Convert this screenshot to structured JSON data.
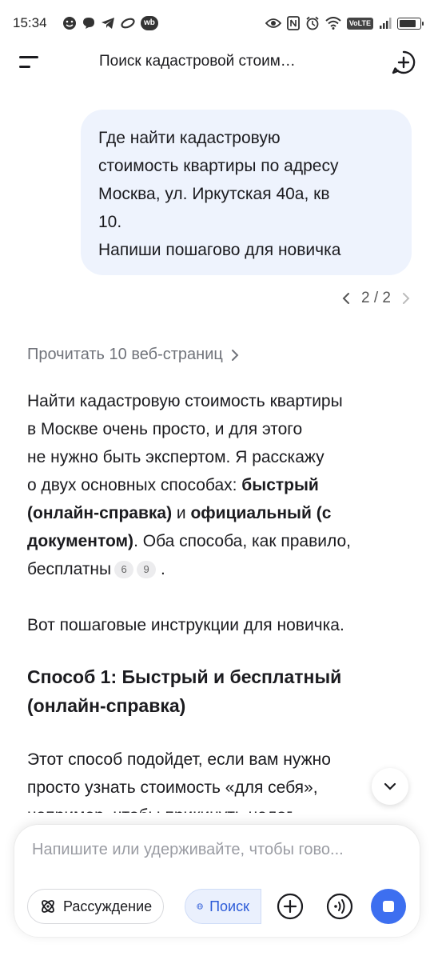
{
  "status_bar": {
    "time": "15:34",
    "wb_badge": "wb",
    "network_badge": "VoLTE",
    "battery_percent": 85
  },
  "header": {
    "title": "Поиск кадастровой стоим…"
  },
  "user_message": {
    "lines": [
      "Где найти кадастровую",
      "стоимость квартиры  по адресу",
      "Москва, ул. Иркутская 40а, кв",
      "10.",
      "Напиши пошагово для новичка"
    ]
  },
  "pager": {
    "label": "2 / 2"
  },
  "answer": {
    "sources_label": "Прочитать 10 веб-страниц",
    "p1": {
      "line1": "Найти кадастровую стоимость квартиры",
      "line2": "в Москве очень просто, и для этого",
      "line3": "не нужно быть экспертом. Я расскажу",
      "line4_a": "о двух основных способах: ",
      "line4_b": "быстрый",
      "line5_a": "(онлайн-справка)",
      "line5_b": " и ",
      "line5_c": "официальный (с",
      "line6_a": "документом)",
      "line6_b": ". Оба способа, как правило,",
      "line7_a": "бесплатны",
      "cite1": "6",
      "cite2": "9",
      "line7_b": " ."
    },
    "p2": "Вот пошаговые инструкции для новичка.",
    "h2": {
      "line1": "Способ 1: Быстрый и бесплатный",
      "line2": "(онлайн-справка)"
    },
    "p3": {
      "line1": "Этот способ подойдет, если вам нужно",
      "line2": "просто узнать стоимость «для себя»,",
      "line3": "например, чтобы прикинуть налог"
    }
  },
  "composer": {
    "placeholder": "Напишите или удерживайте, чтобы гово...",
    "reasoning_label": "Рассуждение",
    "search_label": "Поиск"
  }
}
